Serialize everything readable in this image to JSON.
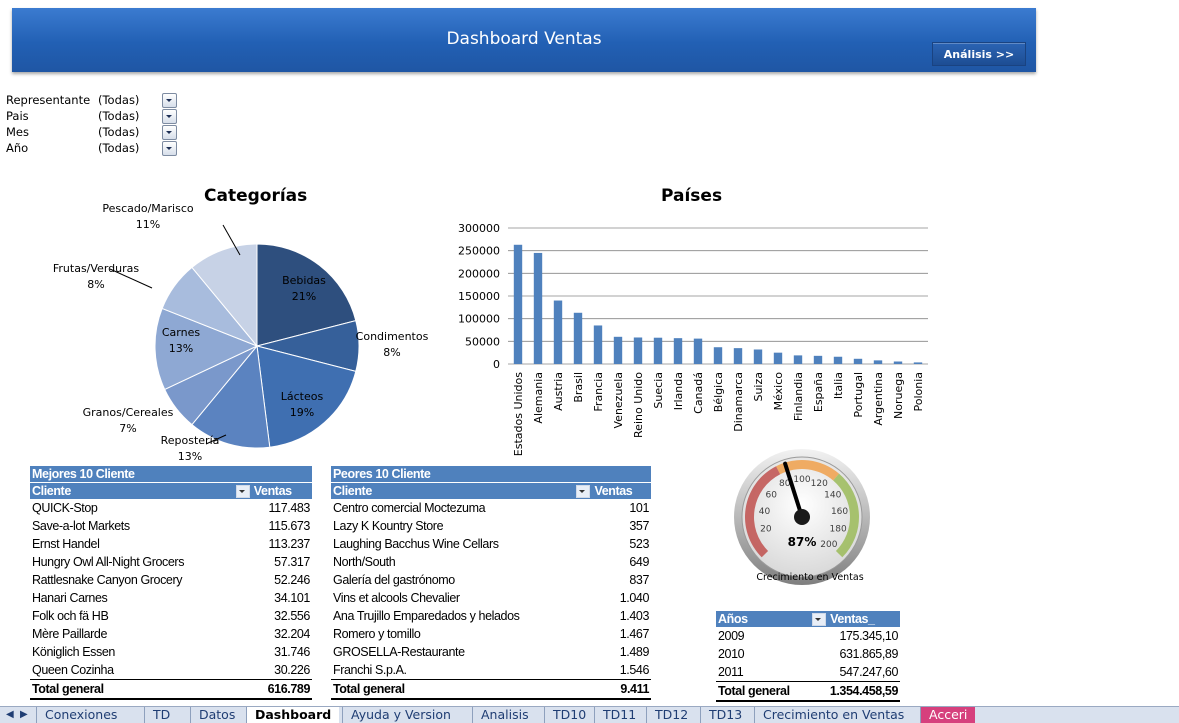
{
  "header": {
    "title": "Dashboard Ventas",
    "button_label": "Análisis >>"
  },
  "filters": [
    {
      "label": "Representante",
      "value": "(Todas)"
    },
    {
      "label": "Pais",
      "value": "(Todas)"
    },
    {
      "label": "Mes",
      "value": "(Todas)"
    },
    {
      "label": "Año",
      "value": "(Todas)"
    }
  ],
  "chart_data": [
    {
      "type": "pie",
      "title": "Categorías",
      "slices": [
        {
          "label": "Bebidas",
          "value": 21,
          "pct": "21%",
          "color": "#2e4f7e"
        },
        {
          "label": "Condimentos",
          "value": 8,
          "pct": "8%",
          "color": "#36609a"
        },
        {
          "label": "Lácteos",
          "value": 19,
          "pct": "19%",
          "color": "#3f6fb1"
        },
        {
          "label": "Repostería",
          "value": 13,
          "pct": "13%",
          "color": "#5b83c0"
        },
        {
          "label": "Granos/Cereales",
          "value": 7,
          "pct": "7%",
          "color": "#7a98cb"
        },
        {
          "label": "Carnes",
          "value": 13,
          "pct": "13%",
          "color": "#8ea8d3"
        },
        {
          "label": "Frutas/Verduras",
          "value": 8,
          "pct": "8%",
          "color": "#a8bcdd"
        },
        {
          "label": "Pescado/Marisco",
          "value": 11,
          "pct": "11%",
          "color": "#c7d2e6"
        }
      ]
    },
    {
      "type": "bar",
      "title": "Países",
      "categories": [
        "Estados Unidos",
        "Alemania",
        "Austria",
        "Brasil",
        "Francia",
        "Venezuela",
        "Reino Unido",
        "Suecia",
        "Irlanda",
        "Canadá",
        "Bélgica",
        "Dinamarca",
        "Suiza",
        "México",
        "Finlandia",
        "España",
        "Italia",
        "Portugal",
        "Argentina",
        "Noruega",
        "Polonia"
      ],
      "values": [
        263000,
        245000,
        140000,
        113000,
        85000,
        60000,
        58500,
        58000,
        57000,
        56000,
        37000,
        35000,
        32000,
        25000,
        19000,
        18000,
        16000,
        11500,
        8000,
        5500,
        3500
      ],
      "ylim": [
        0,
        300000
      ],
      "yticks": [
        "300000",
        "250000",
        "200000",
        "150000",
        "100000",
        "50000",
        "0"
      ],
      "color": "#4f81bd"
    }
  ],
  "gauge": {
    "value_label": "87%",
    "value": 87,
    "ticks": [
      "20",
      "40",
      "60",
      "80",
      "100",
      "120",
      "140",
      "160",
      "180",
      "200"
    ],
    "caption": "Crecimiento en Ventas"
  },
  "best_table": {
    "title": "Mejores 10 Cliente",
    "col_client": "Cliente",
    "col_sales": "Ventas",
    "rows": [
      [
        "QUICK-Stop",
        "117.483"
      ],
      [
        "Save-a-lot Markets",
        "115.673"
      ],
      [
        "Ernst Handel",
        "113.237"
      ],
      [
        "Hungry Owl All-Night Grocers",
        "57.317"
      ],
      [
        "Rattlesnake Canyon Grocery",
        "52.246"
      ],
      [
        "Hanari Carnes",
        "34.101"
      ],
      [
        "Folk och fä HB",
        "32.556"
      ],
      [
        "Mère Paillarde",
        "32.204"
      ],
      [
        "Königlich Essen",
        "31.746"
      ],
      [
        "Queen Cozinha",
        "30.226"
      ]
    ],
    "total_label": "Total general",
    "total_value": "616.789"
  },
  "worst_table": {
    "title": "Peores 10 Cliente",
    "col_client": "Cliente",
    "col_sales": "Ventas",
    "rows": [
      [
        "Centro comercial Moctezuma",
        "101"
      ],
      [
        "Lazy K Kountry Store",
        "357"
      ],
      [
        "Laughing Bacchus Wine Cellars",
        "523"
      ],
      [
        "North/South",
        "649"
      ],
      [
        "Galería del gastrónomo",
        "837"
      ],
      [
        "Vins et alcools Chevalier",
        "1.040"
      ],
      [
        "Ana Trujillo Emparedados y helados",
        "1.403"
      ],
      [
        "Romero y tomillo",
        "1.467"
      ],
      [
        "GROSELLA-Restaurante",
        "1.489"
      ],
      [
        "Franchi S.p.A.",
        "1.546"
      ]
    ],
    "total_label": "Total general",
    "total_value": "9.411"
  },
  "years_table": {
    "col_year": "Años",
    "col_sales": "Ventas_",
    "rows": [
      [
        "2009",
        "175.345,10"
      ],
      [
        "2010",
        "631.865,89"
      ],
      [
        "2011",
        "547.247,60"
      ]
    ],
    "total_label": "Total general",
    "total_value": "1.354.458,59"
  },
  "sheet_tabs": [
    "Conexiones",
    "TD",
    "Datos",
    "Dashboard",
    "Ayuda y Version",
    "Analisis",
    "TD10",
    "TD11",
    "TD12",
    "TD13",
    "Crecimiento en Ventas",
    "Acceri"
  ],
  "active_tab": "Dashboard"
}
